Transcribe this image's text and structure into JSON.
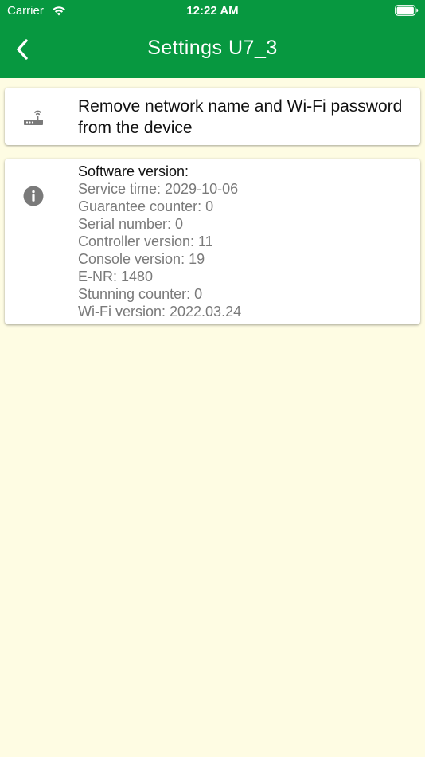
{
  "status_bar": {
    "carrier": "Carrier",
    "time": "12:22 AM",
    "wifi_icon": "wifi-icon",
    "battery_icon": "battery-icon"
  },
  "nav": {
    "title": "Settings U7_3",
    "back_icon": "chevron-left-icon"
  },
  "remove_card": {
    "icon": "router-icon",
    "text": "Remove network name and Wi-Fi password from the device"
  },
  "info_card": {
    "icon": "info-icon",
    "title": "Software version:",
    "rows": [
      "Service time: 2029-10-06",
      "Guarantee counter: 0",
      "Serial number: 0",
      "Controller version: 11",
      "Console version: 19",
      "E-NR: 1480",
      "Stunning counter: 0",
      "Wi-Fi version: 2022.03.24"
    ]
  },
  "colors": {
    "header": "#079840",
    "background": "#fefce3",
    "icon_gray": "#7a7a7a"
  }
}
